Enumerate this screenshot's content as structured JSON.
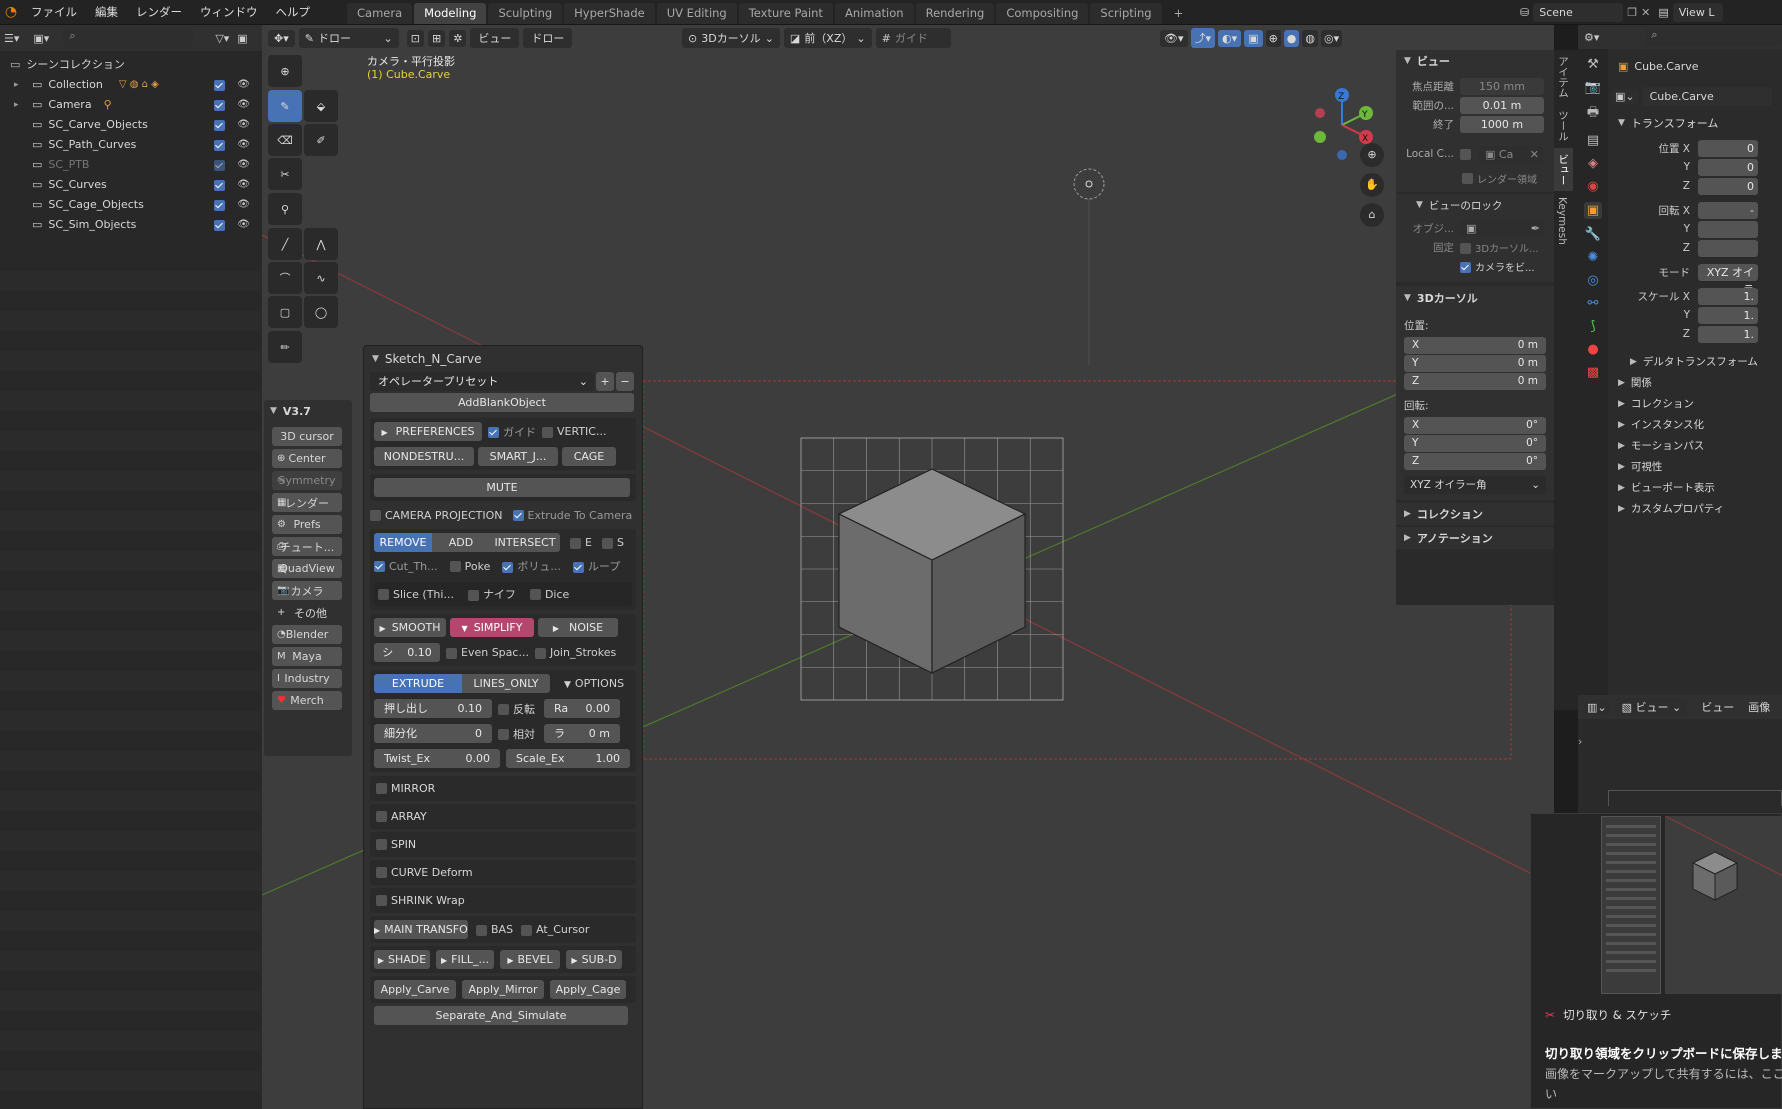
{
  "menu": {
    "app_icon": "blender-icon",
    "file": "ファイル",
    "edit": "編集",
    "render": "レンダー",
    "window": "ウィンドウ",
    "help": "ヘルプ"
  },
  "workspaces": [
    "Camera",
    "Modeling",
    "Sculpting",
    "HyperShade",
    "UV Editing",
    "Texture Paint",
    "Animation",
    "Rendering",
    "Compositing",
    "Scripting"
  ],
  "workspace_add": "+",
  "scene": {
    "name": "Scene",
    "view_layer": "View L"
  },
  "outliner": {
    "root": "シーンコレクション",
    "items": [
      {
        "name": "Collection",
        "dim": false
      },
      {
        "name": "Camera",
        "dim": false
      },
      {
        "name": "SC_Carve_Objects",
        "dim": false
      },
      {
        "name": "SC_Path_Curves",
        "dim": false
      },
      {
        "name": "SC_PTB",
        "dim": true
      },
      {
        "name": "SC_Curves",
        "dim": false
      },
      {
        "name": "SC_Cage_Objects",
        "dim": false
      },
      {
        "name": "SC_Sim_Objects",
        "dim": false
      }
    ]
  },
  "viewport_header": {
    "mode": "ドロー",
    "view": "ビュー",
    "draw": "ドロー",
    "cursor": "3Dカーソル",
    "front": "前（XZ）",
    "guide": "ガイド"
  },
  "viewport": {
    "camera_label": "カメラ・平行投影",
    "object_label": "(1) Cube.Carve"
  },
  "sidebar": {
    "version": "V3.7",
    "buttons": [
      "3D cursor",
      "Center",
      "Symmetry",
      "レンダー",
      "Prefs",
      "チュート...",
      "QuadView",
      "カメラ",
      "その他",
      "Blender",
      "Maya",
      "Industry",
      "Merch"
    ]
  },
  "snc": {
    "title": "Sketch_N_Carve",
    "preset": "オペレータープリセット",
    "add_blank": "AddBlankObject",
    "preferences": "PREFERENCES",
    "guide": "ガイド",
    "vertic": "VERTIC...",
    "nondestru": "NONDESTRU...",
    "smart": "SMART_J...",
    "cage": "CAGE",
    "mute": "MUTE",
    "camera_projection": "CAMERA PROJECTION",
    "extrude_to_camera": "Extrude To Camera",
    "remove": "REMOVE",
    "add": "ADD",
    "intersect": "INTERSECT",
    "e": "E",
    "s": "S",
    "cut_th": "Cut_Th...",
    "poke": "Poke",
    "volume": "ボリュ...",
    "loop": "ループ",
    "slice": "Slice (Thi...",
    "knife": "ナイフ",
    "dice": "Dice",
    "smooth": "SMOOTH",
    "simplify": "SIMPLIFY",
    "noise": "NOISE",
    "si_label": "シ",
    "si_value": "0.10",
    "even_spac": "Even Spac...",
    "join_strokes": "Join_Strokes",
    "extrude": "EXTRUDE",
    "lines_only": "LINES_ONLY",
    "options": "OPTIONS",
    "push_label": "押し出し",
    "push_value": "0.10",
    "invert": "反転",
    "ra_label": "Ra",
    "ra_value": "0.00",
    "subdiv_label": "細分化",
    "subdiv_value": "0",
    "relative": "相対",
    "la_label": "ラ",
    "la_value": "0 m",
    "twist_label": "Twist_Ex",
    "twist_value": "0.00",
    "scale_label": "Scale_Ex",
    "scale_value": "1.00",
    "mirror": "MIRROR",
    "array": "ARRAY",
    "spin": "SPIN",
    "curve_deform": "CURVE Deform",
    "shrink_wrap": "SHRINK Wrap",
    "main_transform": "MAIN TRANSFORM",
    "bas": "BAS",
    "at_cursor": "At_Cursor",
    "shade": "SHADE",
    "fill": "FILL_...",
    "bevel": "BEVEL",
    "subd": "SUB-D",
    "apply_carve": "Apply_Carve",
    "apply_mirror": "Apply_Mirror",
    "apply_cage": "Apply_Cage",
    "separate": "Separate_And_Simulate"
  },
  "npanel": {
    "view_header": "ビュー",
    "focal_label": "焦点距離",
    "focal_value": "150 mm",
    "clip_start_label": "範囲の...",
    "clip_start_value": "0.01 m",
    "clip_end_label": "終了",
    "clip_end_value": "1000 m",
    "local_camera_label": "Local C...",
    "local_camera_value": "Ca",
    "render_region": "レンダー領域",
    "view_lock": "ビューのロック",
    "lock_object_label": "オブジ...",
    "lock_label": "固定",
    "lock_3d_cursor": "3Dカーソル...",
    "camera_to_view": "カメラをビ...",
    "cursor_header": "3Dカーソル",
    "location_label": "位置:",
    "rotation_label": "回転:",
    "loc": [
      {
        "axis": "X",
        "value": "0 m"
      },
      {
        "axis": "Y",
        "value": "0 m"
      },
      {
        "axis": "Z",
        "value": "0 m"
      }
    ],
    "rot": [
      {
        "axis": "X",
        "value": "0°"
      },
      {
        "axis": "Y",
        "value": "0°"
      },
      {
        "axis": "Z",
        "value": "0°"
      }
    ],
    "rot_mode": "XYZ オイラー角",
    "collection": "コレクション",
    "annotation": "アノテーション",
    "tabs": [
      "アイテム",
      "ツール",
      "ビュー",
      "Keymesh"
    ]
  },
  "properties": {
    "object_name": "Cube.Carve",
    "data_name": "Cube.Carve",
    "transform": "トランスフォーム",
    "location_x": "位置 X",
    "y": "Y",
    "z": "Z",
    "rotation_x": "回転 X",
    "mode_label": "モード",
    "mode_value": "XYZ オイラ",
    "scale_x": "スケール X",
    "loc_vals": [
      "0",
      "0",
      "0"
    ],
    "rot_vals": [
      "-",
      "",
      ""
    ],
    "scale_vals": [
      "1.",
      "1.",
      "1."
    ],
    "subpanels": [
      "デルタトランスフォーム",
      "関係",
      "コレクション",
      "インスタンス化",
      "モーションパス",
      "可視性",
      "ビューポート表示",
      "カスタムプロパティ"
    ]
  },
  "image_editor": {
    "view": "ビュー",
    "view2": "ビュー",
    "image": "画像"
  },
  "notification": {
    "app": "切り取り & スケッチ",
    "title": "切り取り領域をクリップボードに保存しました",
    "body": "画像をマークアップして共有するには、ここを選択します",
    "tail": "い"
  }
}
